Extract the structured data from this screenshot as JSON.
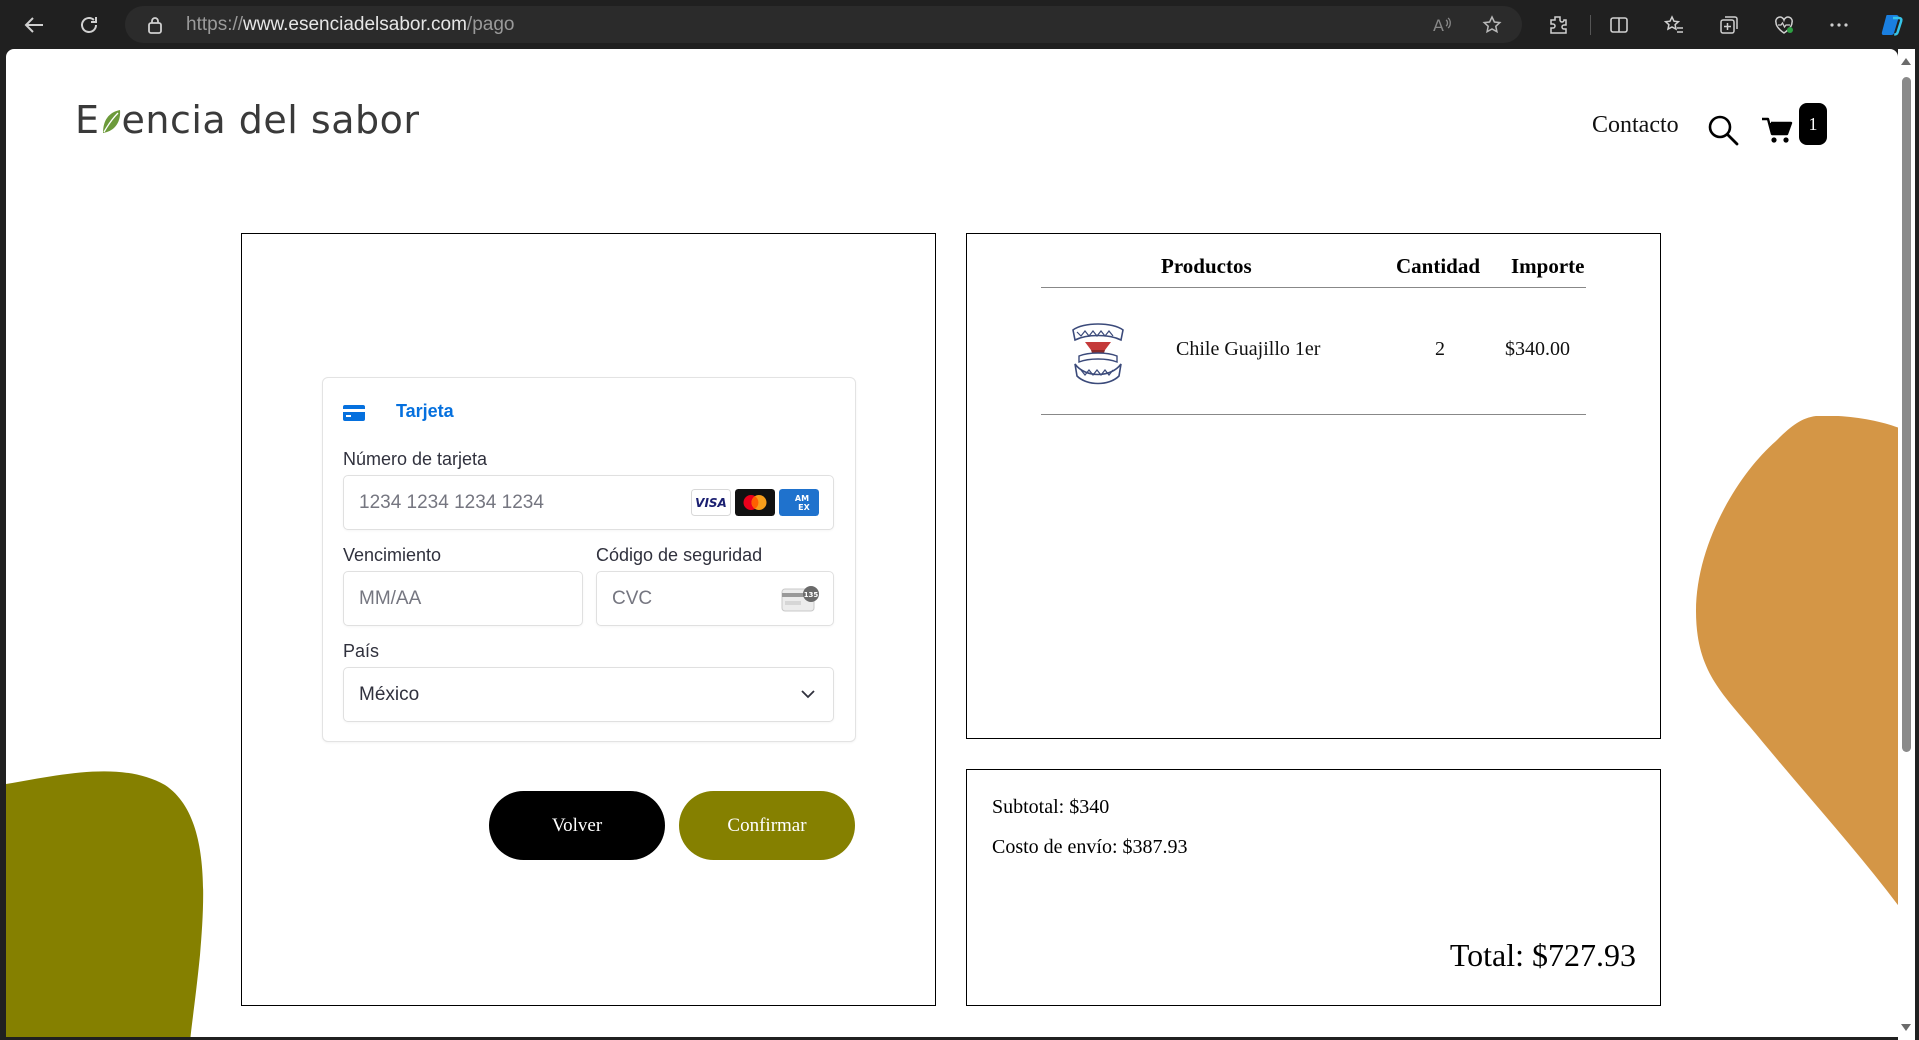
{
  "browser": {
    "url_scheme": "https://",
    "url_host": "www.esenciadelsabor.com",
    "url_path": "/pago"
  },
  "site": {
    "logo_text_first": "E",
    "logo_text_rest": "encia del sabor",
    "nav_contact": "Contacto",
    "cart_count": "1"
  },
  "payment": {
    "tab_label": "Tarjeta",
    "card_number_label": "Número de tarjeta",
    "card_number_placeholder": "1234 1234 1234 1234",
    "card_brands": [
      "visa-icon",
      "mastercard-icon",
      "amex-icon"
    ],
    "expiry_label": "Vencimiento",
    "expiry_placeholder": "MM/AA",
    "cvc_label": "Código de seguridad",
    "cvc_placeholder": "CVC",
    "country_label": "País",
    "country_value": "México",
    "back_button": "Volver",
    "confirm_button": "Confirmar"
  },
  "order": {
    "headers": {
      "products": "Productos",
      "quantity": "Cantidad",
      "amount": "Importe"
    },
    "items": [
      {
        "name": "Chile Guajillo 1er",
        "quantity": "2",
        "amount": "$340.00"
      }
    ]
  },
  "totals": {
    "subtotal": "Subtotal: $340",
    "shipping": "Costo de envío: $387.93",
    "total": "Total: $727.93"
  },
  "colors": {
    "olive": "#858000",
    "orange_blob": "#d49646",
    "stripe_blue": "#0570de"
  }
}
